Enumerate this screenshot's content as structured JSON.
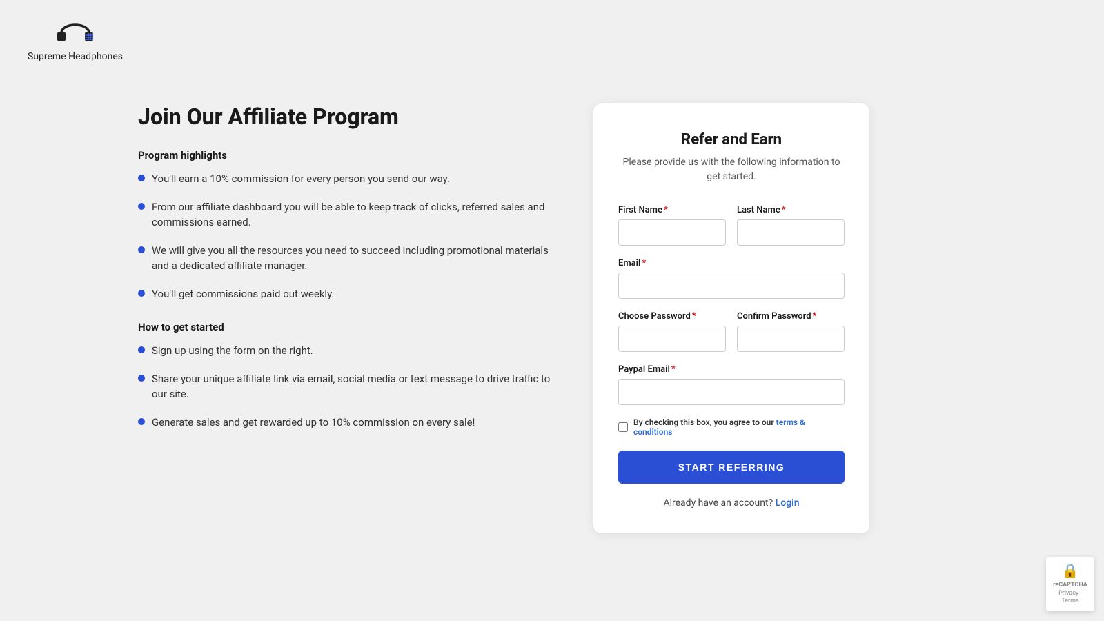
{
  "header": {
    "logo_alt": "Supreme Headphones Logo",
    "brand_name": "Supreme Headphones"
  },
  "left": {
    "page_title": "Join Our Affiliate Program",
    "highlights_heading": "Program highlights",
    "highlights": [
      "You'll earn a 10% commission for every person you send our way.",
      "From our affiliate dashboard you will be able to keep track of clicks, referred sales and commissions earned.",
      "We will give you all the resources you need to succeed including promotional materials and a dedicated affiliate manager.",
      "You'll get commissions paid out weekly."
    ],
    "how_heading": "How to get started",
    "how_items": [
      "Sign up using the form on the right.",
      "Share your unique affiliate link via email, social media or text message to drive traffic to our site.",
      "Generate sales and get rewarded up to 10% commission on every sale!"
    ]
  },
  "form": {
    "title": "Refer and Earn",
    "subtitle": "Please provide us with the following information to get started.",
    "first_name_label": "First Name",
    "last_name_label": "Last Name",
    "email_label": "Email",
    "choose_password_label": "Choose Password",
    "confirm_password_label": "Confirm Password",
    "paypal_email_label": "Paypal Email",
    "checkbox_text": "By checking this box, you agree to our ",
    "terms_text": "terms & conditions",
    "submit_label": "START REFERRING",
    "already_account_text": "Already have an account?",
    "login_text": "Login"
  },
  "recaptcha": {
    "label": "reCAPTCHA",
    "subtext": "Privacy - Terms"
  },
  "colors": {
    "accent": "#2a4fd4",
    "required": "#cc0000",
    "link": "#2a6dd4"
  }
}
